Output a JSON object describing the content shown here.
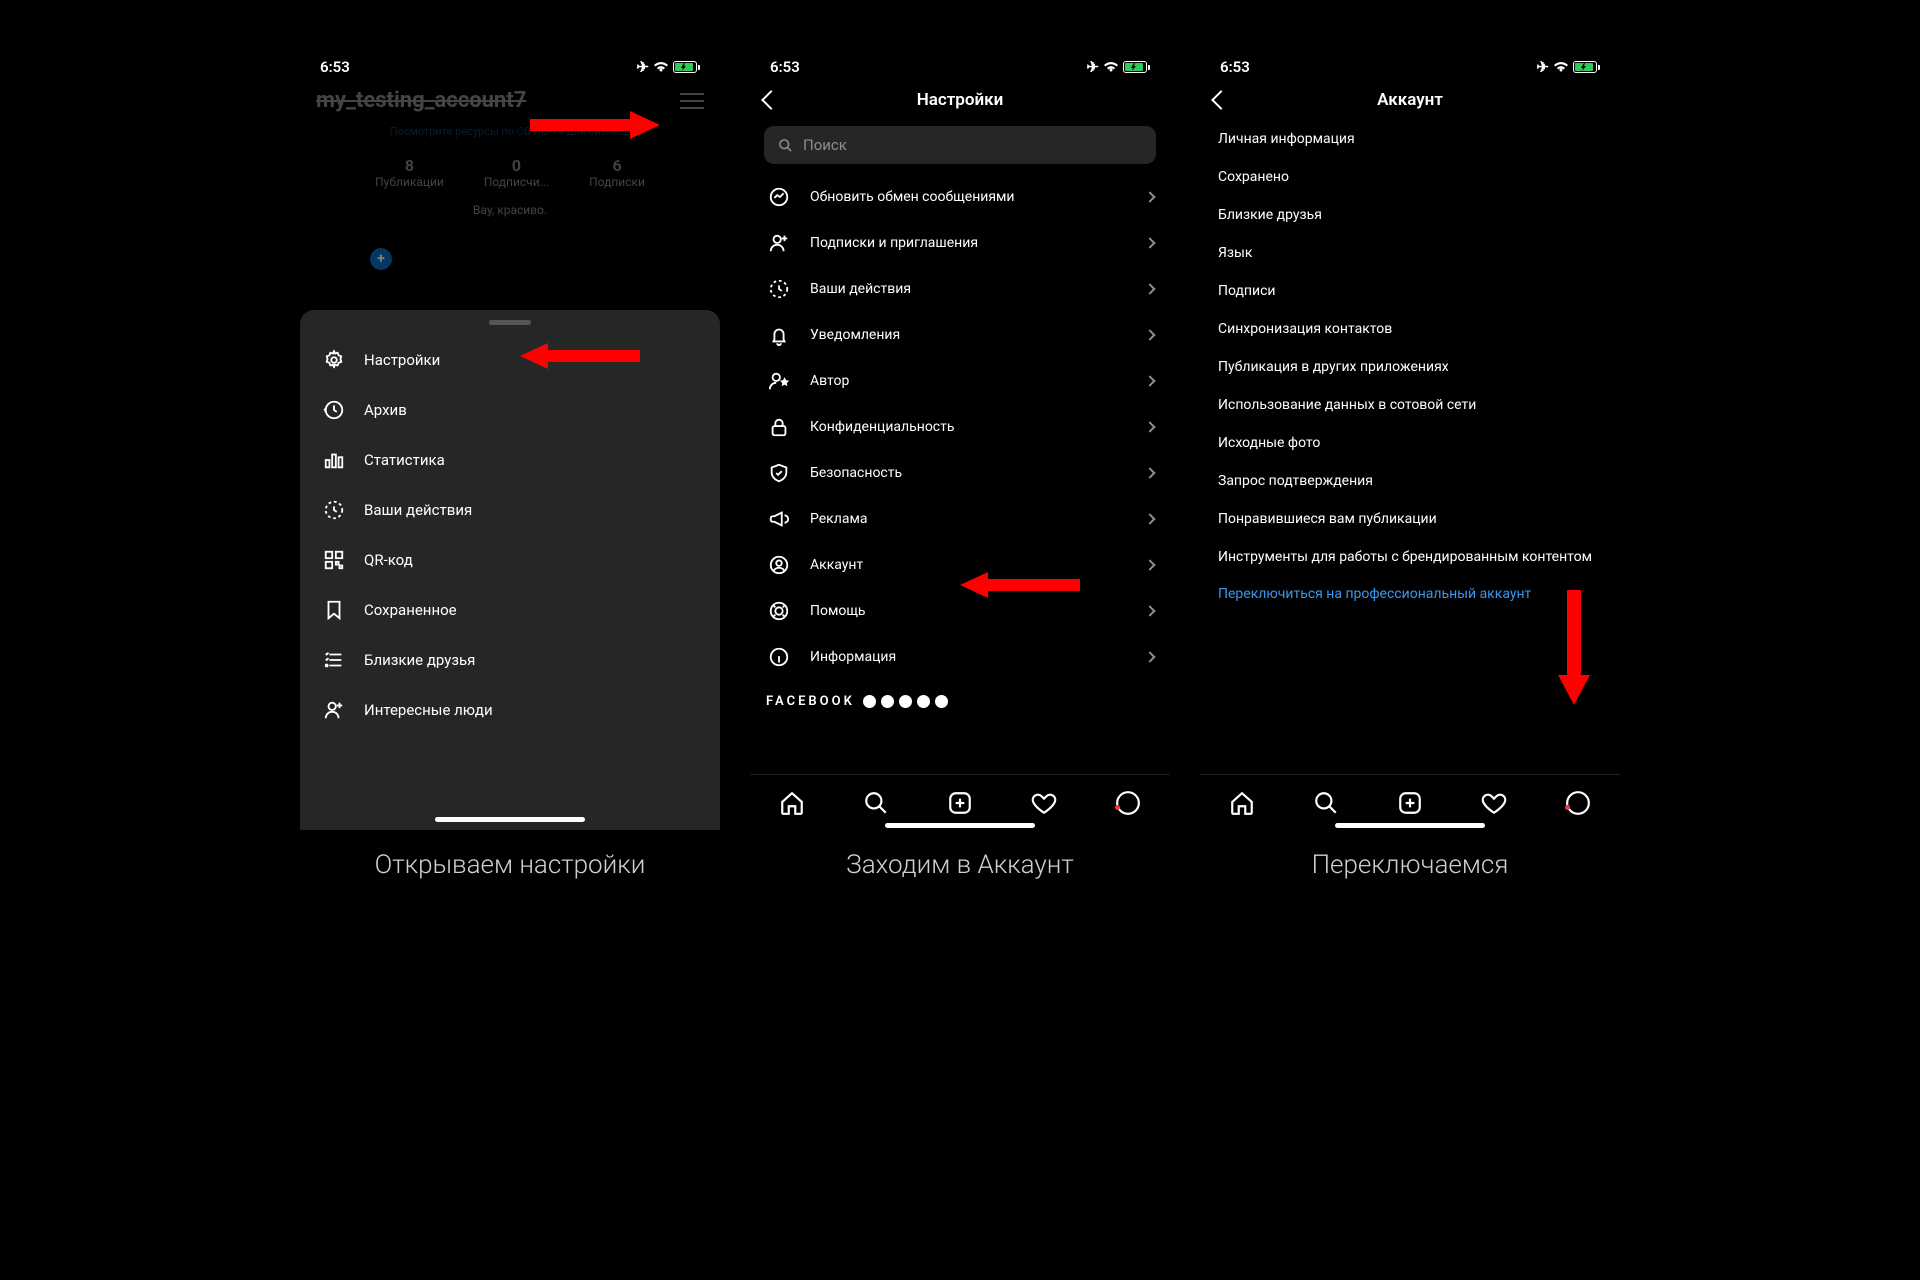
{
  "status": {
    "time": "6:53"
  },
  "screen1": {
    "username": "my_testing_account7",
    "covid_link": "Посмотрите ресурсы по COVID-19 для бизнеса",
    "stats": {
      "posts_n": "8",
      "posts_l": "Публикации",
      "followers_n": "0",
      "followers_l": "Подписчи...",
      "following_n": "6",
      "following_l": "Подписки"
    },
    "bio": "Вау, красиво.",
    "menu": {
      "settings": "Настройки",
      "archive": "Архив",
      "stats": "Статистика",
      "activity": "Ваши действия",
      "qr": "QR-код",
      "saved": "Сохраненное",
      "close_friends": "Близкие друзья",
      "discover": "Интересные люди"
    },
    "caption": "Открываем настройки"
  },
  "screen2": {
    "title": "Настройки",
    "search_placeholder": "Поиск",
    "items": {
      "messaging": "Обновить обмен сообщениями",
      "follows": "Подписки и приглашения",
      "activity": "Ваши действия",
      "notifications": "Уведомления",
      "creator": "Автор",
      "privacy": "Конфиденциальность",
      "security": "Безопасность",
      "ads": "Реклама",
      "account": "Аккаунт",
      "help": "Помощь",
      "about": "Информация"
    },
    "fb_header": "FACEBOOK",
    "caption": "Заходим в Аккаунт"
  },
  "screen3": {
    "title": "Аккаунт",
    "items": {
      "personal": "Личная информация",
      "saved": "Сохранено",
      "close_friends": "Близкие друзья",
      "language": "Язык",
      "captions": "Подписи",
      "contacts": "Синхронизация контактов",
      "crosspost": "Публикация в других приложениях",
      "data": "Использование данных в сотовой сети",
      "original": "Исходные фото",
      "verify": "Запрос подтверждения",
      "liked": "Понравившиеся вам публикации",
      "branded": "Инструменты для работы с брендированным контентом"
    },
    "switch_link": "Переключиться на профессиональный аккаунт",
    "caption": "Переключаемся"
  }
}
